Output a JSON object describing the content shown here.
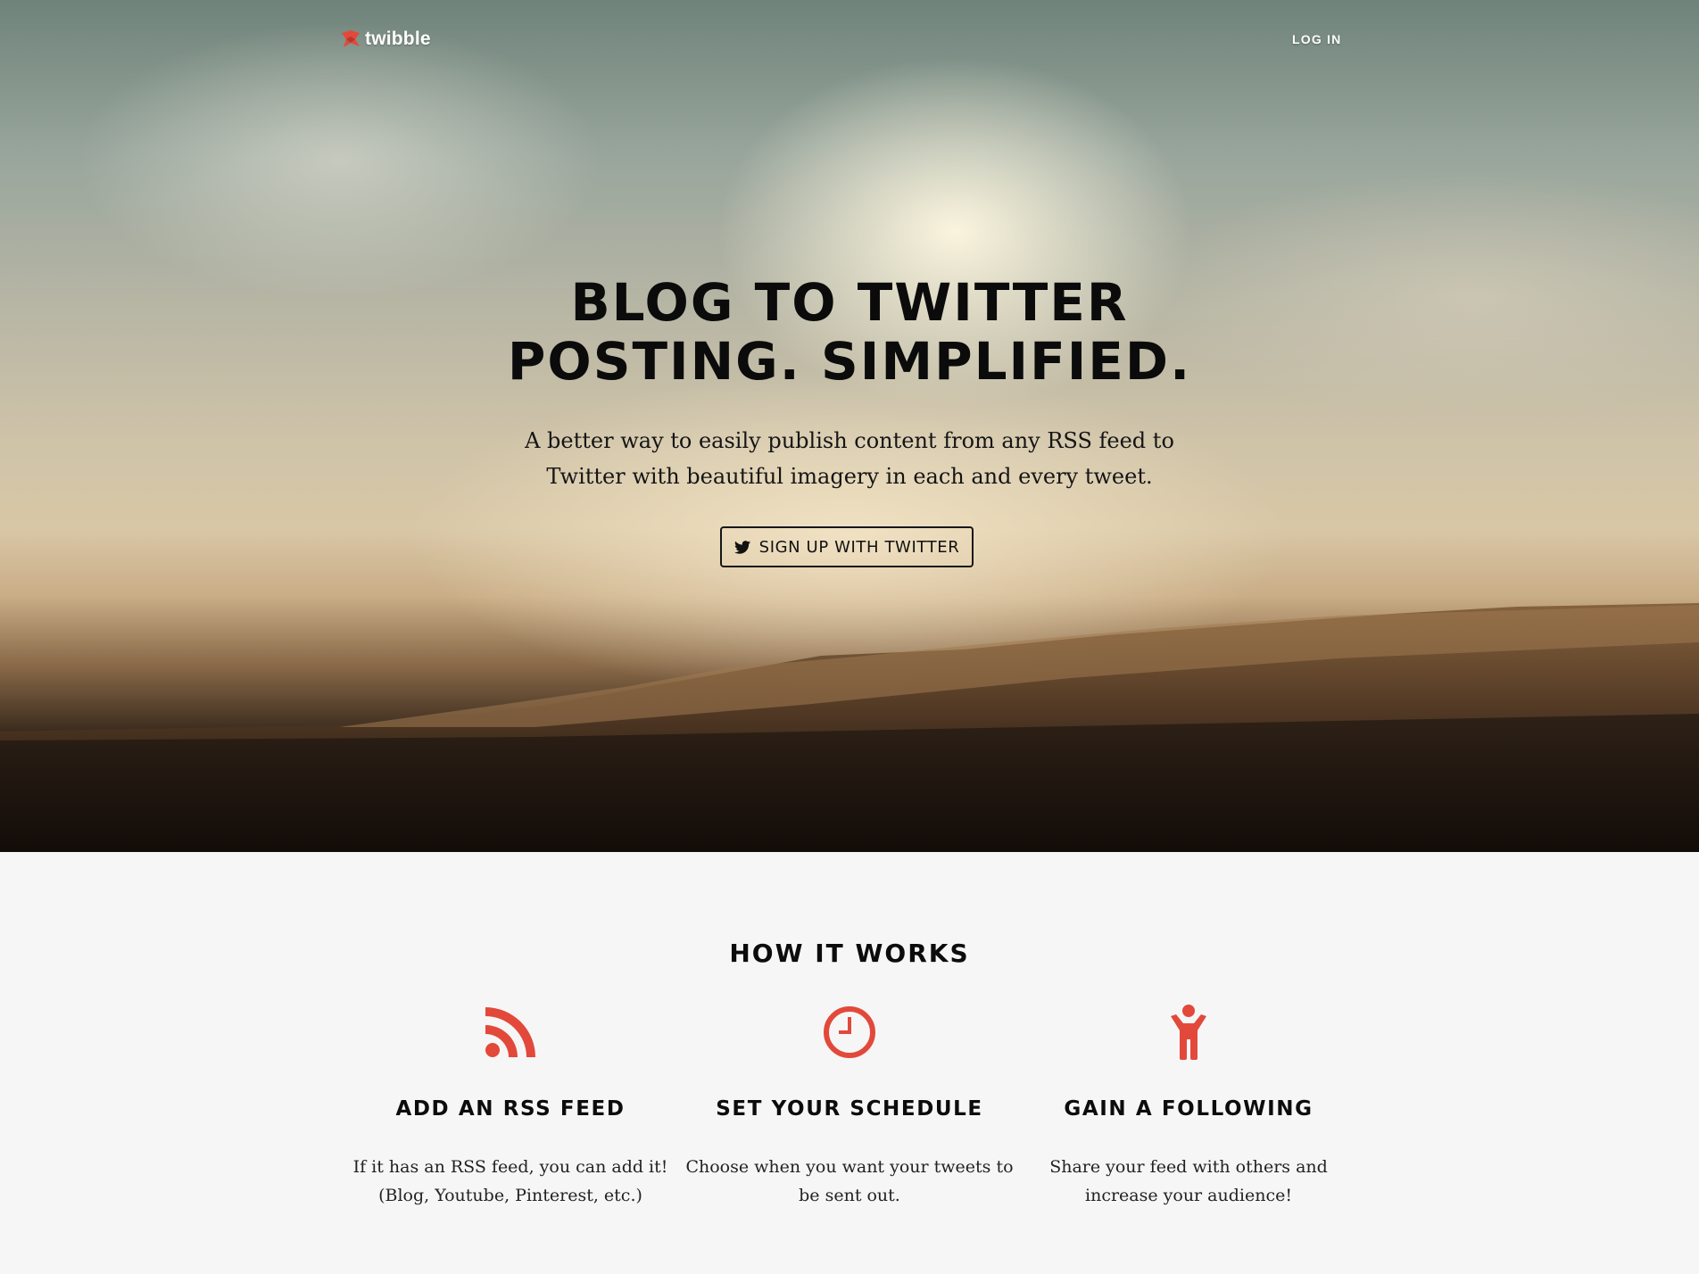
{
  "header": {
    "logo_text": "twibble",
    "login_label": "LOG IN"
  },
  "hero": {
    "headline_line1": "BLOG TO TWITTER",
    "headline_line2": "POSTING. SIMPLIFIED.",
    "subheadline": "A better way to easily publish content from any RSS feed to Twitter with beautiful imagery in each and every tweet.",
    "cta_label": "SIGN UP WITH TWITTER",
    "cta_icon": "twitter-bird-icon"
  },
  "how_it_works": {
    "title": "HOW IT WORKS",
    "accent_color": "#e2493b",
    "features": [
      {
        "icon": "rss-icon",
        "title": "ADD AN RSS FEED",
        "description": "If it has an RSS feed, you can add it! (Blog, Youtube, Pinterest, etc.)"
      },
      {
        "icon": "clock-icon",
        "title": "SET YOUR SCHEDULE",
        "description": "Choose when you want your tweets to be sent out."
      },
      {
        "icon": "person-icon",
        "title": "GAIN A FOLLOWING",
        "description": "Share your feed with others and increase your audience!"
      }
    ]
  }
}
